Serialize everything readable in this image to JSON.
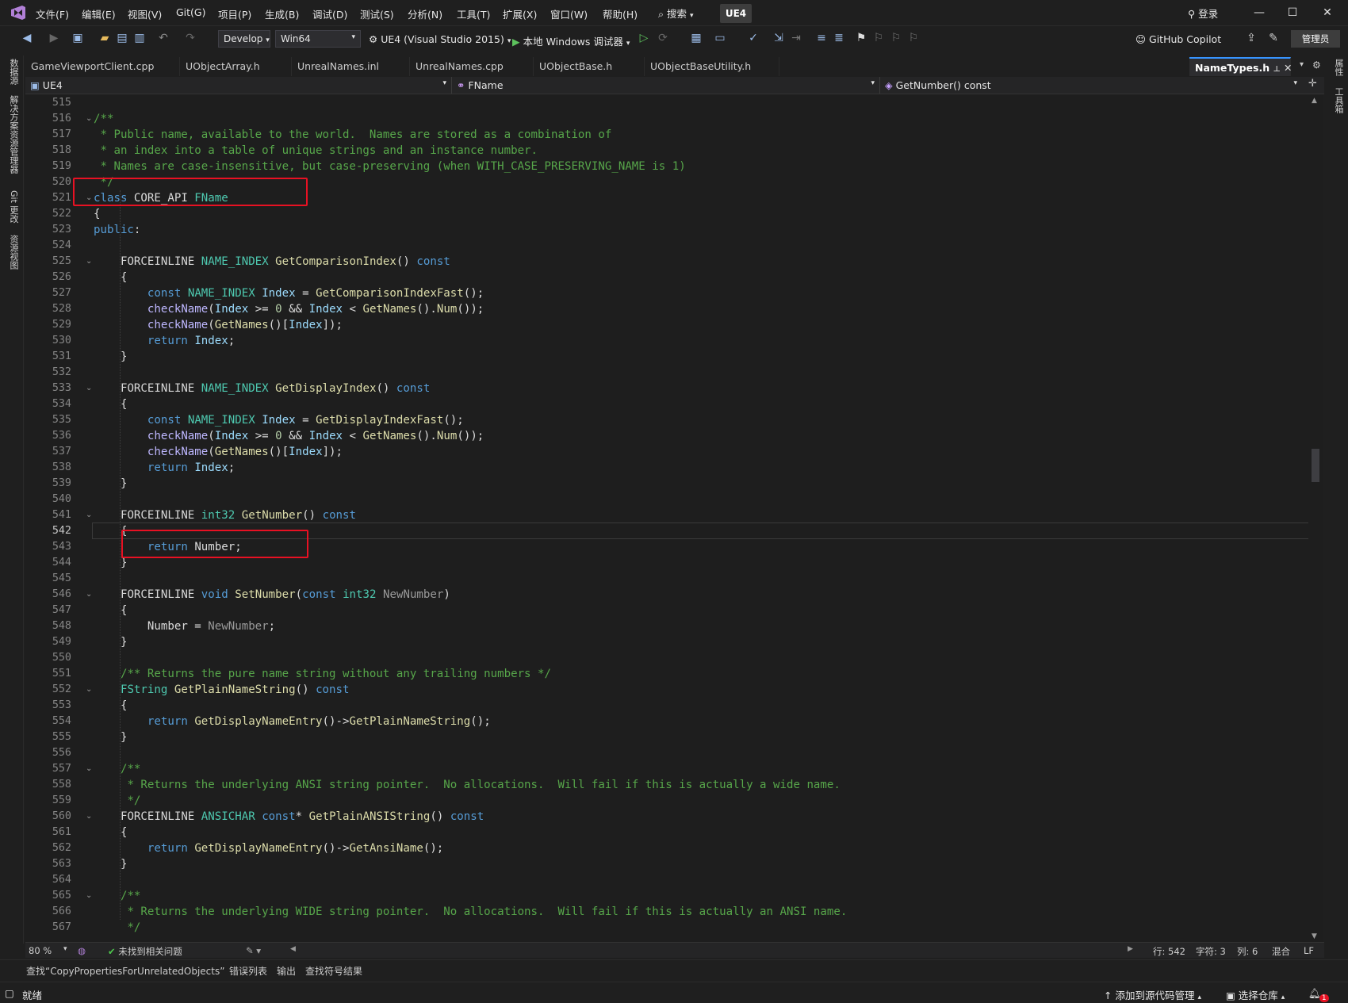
{
  "menu": {
    "items": [
      "文件(F)",
      "编辑(E)",
      "视图(V)",
      "Git(G)",
      "项目(P)",
      "生成(B)",
      "调试(D)",
      "测试(S)",
      "分析(N)",
      "工具(T)",
      "扩展(X)",
      "窗口(W)",
      "帮助(H)"
    ],
    "search_label": "搜索",
    "solution_name": "UE4",
    "login_label": "登录"
  },
  "toolbar": {
    "config": "Develop",
    "platform": "Win64",
    "startup_project": "UE4 (Visual Studio 2015)",
    "debug_target": "本地 Windows 调试器",
    "copilot_label": "GitHub Copilot",
    "admin_label": "管理员"
  },
  "left_strip": [
    "数据源",
    "解决方案资源管理器",
    "Git 更改",
    "资源视图"
  ],
  "right_strip": [
    "属性",
    "工具箱"
  ],
  "tabs": [
    {
      "label": "GameViewportClient.cpp"
    },
    {
      "label": "UObjectArray.h"
    },
    {
      "label": "UnrealNames.inl"
    },
    {
      "label": "UnrealNames.cpp"
    },
    {
      "label": "UObjectBase.h"
    },
    {
      "label": "UObjectBaseUtility.h"
    }
  ],
  "active_tab": {
    "label": "NameTypes.h"
  },
  "nav": {
    "project": "UE4",
    "scope": "FName",
    "member": "GetNumber() const"
  },
  "editor": {
    "current_line": 542,
    "lines": [
      {
        "n": 515,
        "text": "",
        "html": ""
      },
      {
        "n": 516,
        "text": "/**",
        "html": "<span style=\"color:#57a64a\">/**</span>",
        "fold": true
      },
      {
        "n": 517,
        "text": " * Public name, available to the world.  Names are stored as a combination of",
        "html": "<span style=\"color:#57a64a\"> * Public name, available to the world.  Names are stored as a combination of</span>"
      },
      {
        "n": 518,
        "text": " * an index into a table of unique strings and an instance number.",
        "html": "<span style=\"color:#57a64a\"> * an index into a table of unique strings and an instance number.</span>"
      },
      {
        "n": 519,
        "text": " * Names are case-insensitive, but case-preserving (when WITH_CASE_PRESERVING_NAME is 1)",
        "html": "<span style=\"color:#57a64a\"> * Names are case-insensitive, but case-preserving (when WITH_CASE_PRESERVING_NAME is 1)</span>"
      },
      {
        "n": 520,
        "text": " */",
        "html": "<span style=\"color:#57a64a\"> */</span>"
      },
      {
        "n": 521,
        "text": "class CORE_API FName",
        "html": "<span style=\"color:#569cd6\">class</span> CORE_API <span style=\"color:#4ec9b0\">FName</span>",
        "fold": true
      },
      {
        "n": 522,
        "text": "{",
        "html": "{"
      },
      {
        "n": 523,
        "text": "public:",
        "html": "<span style=\"color:#569cd6\">public</span>:"
      },
      {
        "n": 524,
        "text": "",
        "html": ""
      },
      {
        "n": 525,
        "text": "    FORCEINLINE NAME_INDEX GetComparisonIndex() const",
        "html": "    <span style=\"color:#d8d8d8\">FORCEINLINE</span> <span style=\"color:#4ec9b0\">NAME_INDEX</span> <span style=\"color:#dcdcaa\">GetComparisonIndex</span>() <span style=\"color:#569cd6\">const</span>",
        "fold": true
      },
      {
        "n": 526,
        "text": "    {",
        "html": "    {"
      },
      {
        "n": 527,
        "text": "        const NAME_INDEX Index = GetComparisonIndexFast();",
        "html": "        <span style=\"color:#569cd6\">const</span> <span style=\"color:#4ec9b0\">NAME_INDEX</span> <span style=\"color:#9cdcfe\">Index</span> = <span style=\"color:#dcdcaa\">GetComparisonIndexFast</span>();"
      },
      {
        "n": 528,
        "text": "        checkName(Index >= 0 && Index < GetNames().Num());",
        "html": "        <span style=\"color:#beb7ff\">checkName</span>(<span style=\"color:#9cdcfe\">Index</span> >= <span style=\"color:#b5cea8\">0</span> &amp;&amp; <span style=\"color:#9cdcfe\">Index</span> &lt; <span style=\"color:#dcdcaa\">GetNames</span>().<span style=\"color:#dcdcaa\">Num</span>());"
      },
      {
        "n": 529,
        "text": "        checkName(GetNames()[Index]);",
        "html": "        <span style=\"color:#beb7ff\">checkName</span>(<span style=\"color:#dcdcaa\">GetNames</span>()[<span style=\"color:#9cdcfe\">Index</span>]);"
      },
      {
        "n": 530,
        "text": "        return Index;",
        "html": "        <span style=\"color:#569cd6\">return</span> <span style=\"color:#9cdcfe\">Index</span>;"
      },
      {
        "n": 531,
        "text": "    }",
        "html": "    }"
      },
      {
        "n": 532,
        "text": "",
        "html": ""
      },
      {
        "n": 533,
        "text": "    FORCEINLINE NAME_INDEX GetDisplayIndex() const",
        "html": "    <span style=\"color:#d8d8d8\">FORCEINLINE</span> <span style=\"color:#4ec9b0\">NAME_INDEX</span> <span style=\"color:#dcdcaa\">GetDisplayIndex</span>() <span style=\"color:#569cd6\">const</span>",
        "fold": true
      },
      {
        "n": 534,
        "text": "    {",
        "html": "    {"
      },
      {
        "n": 535,
        "text": "        const NAME_INDEX Index = GetDisplayIndexFast();",
        "html": "        <span style=\"color:#569cd6\">const</span> <span style=\"color:#4ec9b0\">NAME_INDEX</span> <span style=\"color:#9cdcfe\">Index</span> = <span style=\"color:#dcdcaa\">GetDisplayIndexFast</span>();"
      },
      {
        "n": 536,
        "text": "        checkName(Index >= 0 && Index < GetNames().Num());",
        "html": "        <span style=\"color:#beb7ff\">checkName</span>(<span style=\"color:#9cdcfe\">Index</span> >= <span style=\"color:#b5cea8\">0</span> &amp;&amp; <span style=\"color:#9cdcfe\">Index</span> &lt; <span style=\"color:#dcdcaa\">GetNames</span>().<span style=\"color:#dcdcaa\">Num</span>());"
      },
      {
        "n": 537,
        "text": "        checkName(GetNames()[Index]);",
        "html": "        <span style=\"color:#beb7ff\">checkName</span>(<span style=\"color:#dcdcaa\">GetNames</span>()[<span style=\"color:#9cdcfe\">Index</span>]);"
      },
      {
        "n": 538,
        "text": "        return Index;",
        "html": "        <span style=\"color:#569cd6\">return</span> <span style=\"color:#9cdcfe\">Index</span>;"
      },
      {
        "n": 539,
        "text": "    }",
        "html": "    }"
      },
      {
        "n": 540,
        "text": "",
        "html": ""
      },
      {
        "n": 541,
        "text": "    FORCEINLINE int32 GetNumber() const",
        "html": "    <span style=\"color:#d8d8d8\">FORCEINLINE</span> <span style=\"color:#4ec9b0\">int32</span> <span style=\"color:#dcdcaa\">GetNumber</span>() <span style=\"color:#569cd6\">const</span>",
        "fold": true
      },
      {
        "n": 542,
        "text": "    {",
        "html": "    {"
      },
      {
        "n": 543,
        "text": "        return Number;",
        "html": "        <span style=\"color:#569cd6\">return</span> <span style=\"color:#dadada\">Number</span>;"
      },
      {
        "n": 544,
        "text": "    }",
        "html": "    }"
      },
      {
        "n": 545,
        "text": "",
        "html": ""
      },
      {
        "n": 546,
        "text": "    FORCEINLINE void SetNumber(const int32 NewNumber)",
        "html": "    <span style=\"color:#d8d8d8\">FORCEINLINE</span> <span style=\"color:#569cd6\">void</span> <span style=\"color:#dcdcaa\">SetNumber</span>(<span style=\"color:#569cd6\">const</span> <span style=\"color:#4ec9b0\">int32</span> <span style=\"color:#9a9a9a\">NewNumber</span>)",
        "fold": true
      },
      {
        "n": 547,
        "text": "    {",
        "html": "    {"
      },
      {
        "n": 548,
        "text": "        Number = NewNumber;",
        "html": "        <span style=\"color:#dadada\">Number</span> = <span style=\"color:#9a9a9a\">NewNumber</span>;"
      },
      {
        "n": 549,
        "text": "    }",
        "html": "    }"
      },
      {
        "n": 550,
        "text": "",
        "html": ""
      },
      {
        "n": 551,
        "text": "    /** Returns the pure name string without any trailing numbers */",
        "html": "    <span style=\"color:#57a64a\">/** Returns the pure name string without any trailing numbers */</span>"
      },
      {
        "n": 552,
        "text": "    FString GetPlainNameString() const",
        "html": "    <span style=\"color:#4ec9b0\">FString</span> <span style=\"color:#dcdcaa\">GetPlainNameString</span>() <span style=\"color:#569cd6\">const</span>",
        "fold": true
      },
      {
        "n": 553,
        "text": "    {",
        "html": "    {"
      },
      {
        "n": 554,
        "text": "        return GetDisplayNameEntry()->GetPlainNameString();",
        "html": "        <span style=\"color:#569cd6\">return</span> <span style=\"color:#dcdcaa\">GetDisplayNameEntry</span>()-><span style=\"color:#dcdcaa\">GetPlainNameString</span>();"
      },
      {
        "n": 555,
        "text": "    }",
        "html": "    }"
      },
      {
        "n": 556,
        "text": "",
        "html": ""
      },
      {
        "n": 557,
        "text": "    /**",
        "html": "    <span style=\"color:#57a64a\">/**</span>",
        "fold": true
      },
      {
        "n": 558,
        "text": "     * Returns the underlying ANSI string pointer.  No allocations.  Will fail if this is actually a wide name.",
        "html": "    <span style=\"color:#57a64a\"> * Returns the underlying ANSI string pointer.  No allocations.  Will fail if this is actually a wide name.</span>"
      },
      {
        "n": 559,
        "text": "     */",
        "html": "    <span style=\"color:#57a64a\"> */</span>"
      },
      {
        "n": 560,
        "text": "    FORCEINLINE ANSICHAR const* GetPlainANSIString() const",
        "html": "    <span style=\"color:#d8d8d8\">FORCEINLINE</span> <span style=\"color:#4ec9b0\">ANSICHAR</span> <span style=\"color:#569cd6\">const</span>* <span style=\"color:#dcdcaa\">GetPlainANSIString</span>() <span style=\"color:#569cd6\">const</span>",
        "fold": true
      },
      {
        "n": 561,
        "text": "    {",
        "html": "    {"
      },
      {
        "n": 562,
        "text": "        return GetDisplayNameEntry()->GetAnsiName();",
        "html": "        <span style=\"color:#569cd6\">return</span> <span style=\"color:#dcdcaa\">GetDisplayNameEntry</span>()-><span style=\"color:#dcdcaa\">GetAnsiName</span>();"
      },
      {
        "n": 563,
        "text": "    }",
        "html": "    }"
      },
      {
        "n": 564,
        "text": "",
        "html": ""
      },
      {
        "n": 565,
        "text": "    /**",
        "html": "    <span style=\"color:#57a64a\">/**</span>",
        "fold": true
      },
      {
        "n": 566,
        "text": "     * Returns the underlying WIDE string pointer.  No allocations.  Will fail if this is actually an ANSI name.",
        "html": "    <span style=\"color:#57a64a\"> * Returns the underlying WIDE string pointer.  No allocations.  Will fail if this is actually an ANSI name.</span>"
      },
      {
        "n": 567,
        "text": "     */",
        "html": "    <span style=\"color:#57a64a\"> */</span>"
      }
    ]
  },
  "editor_status": {
    "zoom": "80 %",
    "issues": "未找到相关问题",
    "line": "行: 542",
    "char": "字符: 3",
    "col": "列: 6",
    "whitespace": "混合",
    "eol": "LF"
  },
  "bottom_tabs": [
    "查找“CopyPropertiesForUnrelatedObjects”",
    "错误列表",
    "输出",
    "查找符号结果"
  ],
  "status": {
    "ready": "就绪",
    "add_source_control": "添加到源代码管理",
    "select_repo": "选择仓库",
    "notification_count": "1"
  },
  "colors": {
    "accent": "#3794ff",
    "highlight_box": "#e81123",
    "background": "#1e1e1e"
  }
}
